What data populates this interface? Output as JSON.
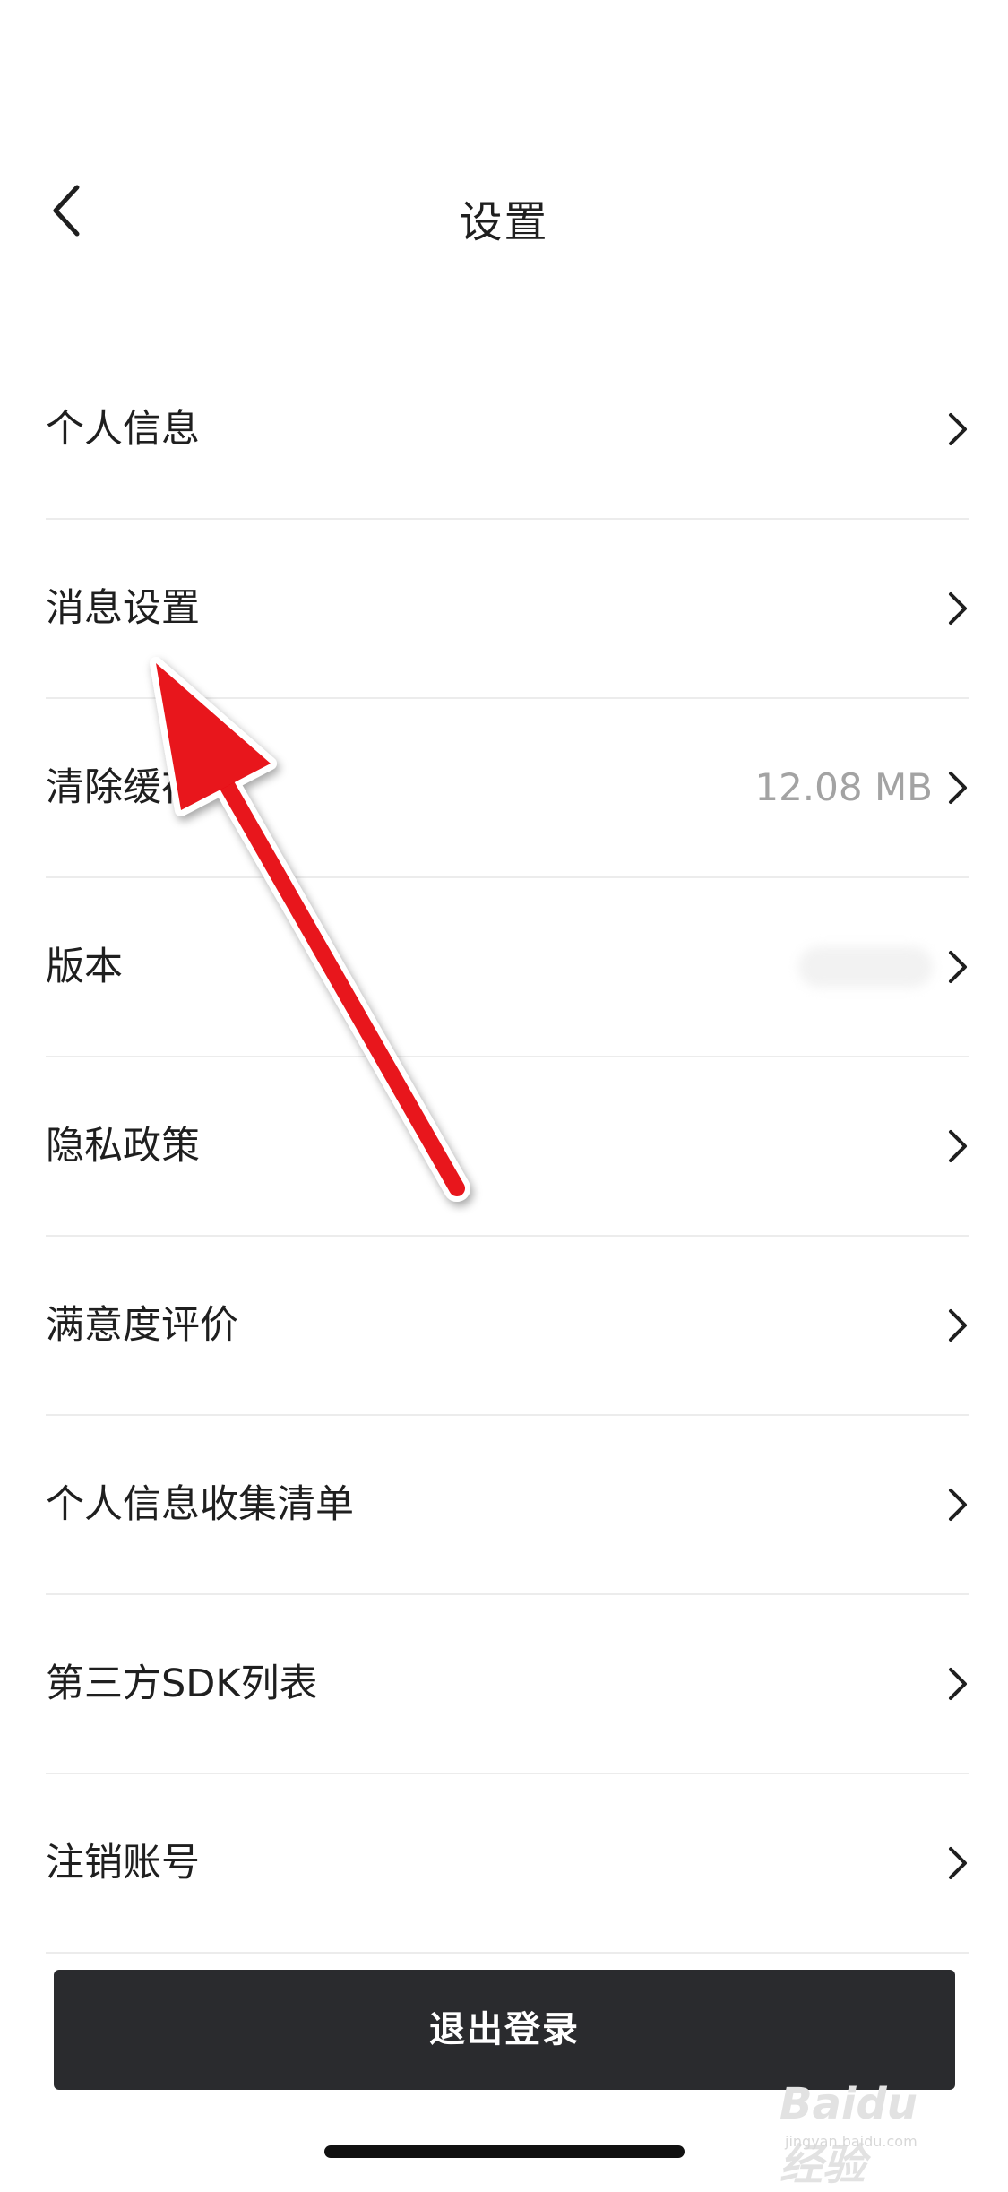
{
  "header": {
    "title": "设置",
    "back_icon": "chevron-left-icon"
  },
  "settings": [
    {
      "id": "personal-info",
      "label": "个人信息",
      "value": ""
    },
    {
      "id": "message-settings",
      "label": "消息设置",
      "value": ""
    },
    {
      "id": "clear-cache",
      "label": "清除缓存",
      "value": "12.08 MB"
    },
    {
      "id": "version",
      "label": "版本",
      "value": ""
    },
    {
      "id": "privacy-policy",
      "label": "隐私政策",
      "value": ""
    },
    {
      "id": "satisfaction-rating",
      "label": "满意度评价",
      "value": ""
    },
    {
      "id": "personal-info-collection",
      "label": "个人信息收集清单",
      "value": ""
    },
    {
      "id": "third-party-sdk",
      "label": "第三方SDK列表",
      "value": ""
    },
    {
      "id": "delete-account",
      "label": "注销账号",
      "value": ""
    }
  ],
  "logout_button": {
    "label": "退出登录"
  },
  "watermark": {
    "logo": "Baidu经验",
    "url": "jingyan.baidu.com"
  },
  "colors": {
    "annotation_arrow": "#e8121a",
    "logout_bg": "#2a2b2e",
    "secondary_text": "#a3a3a3",
    "divider": "#ececec"
  }
}
